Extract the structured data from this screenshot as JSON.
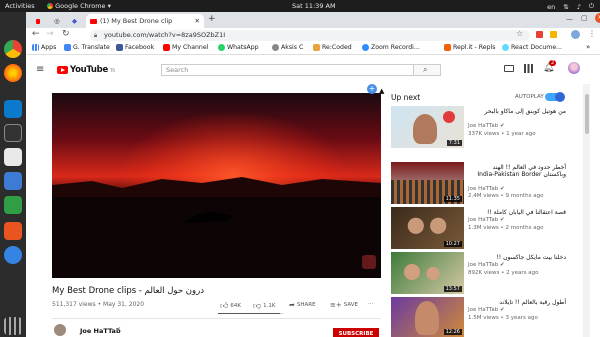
{
  "os": {
    "activities": "Activities",
    "app_menu": "Google Chrome",
    "clock": "Sat 11:39 AM",
    "lang": "en"
  },
  "browser": {
    "tab_title": "(1) My Best Drone clip",
    "new_tab": "+",
    "url": "youtube.com/watch?v=8za9SOZbZ1I",
    "bookmarks": [
      "Apps",
      "G. Translate",
      "Facebook",
      "My Channel",
      "WhatsApp",
      "Aksis C",
      "Re:Coded",
      "Zoom Recordi...",
      "Repl.it - Repls",
      "React Docume..."
    ]
  },
  "youtube": {
    "logo": "YouTube",
    "region": "TR",
    "search_placeholder": "Search",
    "notif_count": "2",
    "video": {
      "title": "My Best Drone clips - درون حول العالم",
      "views": "511,317 views",
      "date": "May 31, 2020",
      "likes": "64K",
      "dislikes": "1.1K",
      "share": "SHARE",
      "save": "SAVE",
      "more": "···",
      "channel": "Joe HaTTab",
      "subscribe": "SUBSCRIBE"
    },
    "upnext": {
      "heading": "Up next",
      "autoplay": "AUTOPLAY",
      "items": [
        {
          "title": "من هوتيل كوبنق إلى ماكاو بالبحر",
          "channel": "Joe HaTTab",
          "views": "337K views",
          "age": "1 year ago",
          "duration": "7:31"
        },
        {
          "title": "أخطر حدود في العالم !! الهند وباكستان India-Pakistan Border",
          "channel": "Joe HaTTab",
          "views": "2.4M views",
          "age": "9 months ago",
          "duration": "11:35"
        },
        {
          "title": "قصة اعتقالنا في اليابان كاملة !!",
          "channel": "Joe HaTTab",
          "views": "1.3M views",
          "age": "2 months ago",
          "duration": "10:27"
        },
        {
          "title": "دخلنا بيت مايكل جاكسون !!",
          "channel": "Joe HaTTab",
          "views": "892K views",
          "age": "2 years ago",
          "duration": "13:57"
        },
        {
          "title": "أطول رقبة بالعالم !! تايلاند",
          "channel": "Joe HaTTab",
          "views": "1.5M views",
          "age": "3 years ago",
          "duration": "12:26"
        }
      ]
    }
  },
  "colors": {
    "yt_red": "#ff0000",
    "accent_blue": "#3ea6ff",
    "subscribe": "#cc0000"
  }
}
